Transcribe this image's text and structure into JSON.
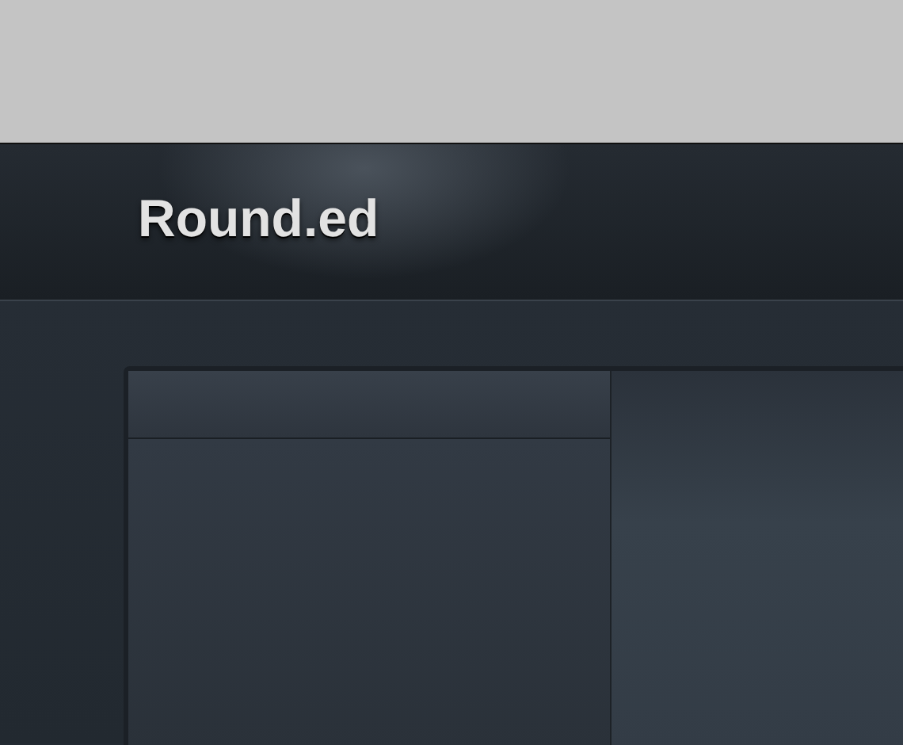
{
  "header": {
    "logo": "Round.ed"
  }
}
